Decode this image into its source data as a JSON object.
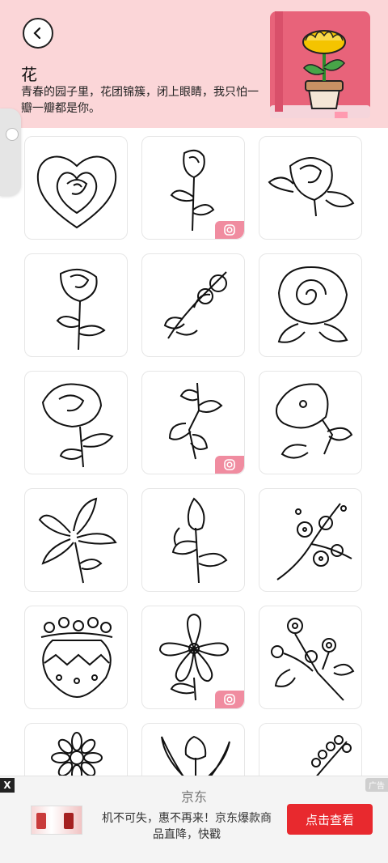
{
  "header": {
    "title": "花",
    "description": "青春的园子里，花团锦簇，闭上眼睛，我只怕一瓣一瓣都是你。"
  },
  "grid": {
    "items": [
      {
        "name": "heart-rose",
        "badge": false
      },
      {
        "name": "rose-bud-stem",
        "badge": true
      },
      {
        "name": "rose-with-leaves",
        "badge": false
      },
      {
        "name": "rose-long-stem",
        "badge": false
      },
      {
        "name": "flower-branch",
        "badge": false
      },
      {
        "name": "swirl-rose",
        "badge": false
      },
      {
        "name": "rose-with-leaves-2",
        "badge": false
      },
      {
        "name": "bell-flowers",
        "badge": true
      },
      {
        "name": "morning-glory",
        "badge": false
      },
      {
        "name": "lily",
        "badge": false
      },
      {
        "name": "calla-lily",
        "badge": false
      },
      {
        "name": "plum-blossom-branch",
        "badge": false
      },
      {
        "name": "flower-vase",
        "badge": false
      },
      {
        "name": "five-petal-flower",
        "badge": true
      },
      {
        "name": "flower-bouquet",
        "badge": false
      },
      {
        "name": "daisy",
        "badge": false
      },
      {
        "name": "tulip-leaves",
        "badge": false
      },
      {
        "name": "berry-branch",
        "badge": false
      }
    ]
  },
  "ad": {
    "close": "X",
    "tag": "广告",
    "brand": "京东",
    "text": "机不可失，惠不再来！京东爆款商品直降，快戳",
    "button": "点击查看"
  },
  "colors": {
    "header_bg": "#fbd6d8",
    "badge": "#f08ca0",
    "ad_button": "#e8292e",
    "book": "#e8637a"
  }
}
